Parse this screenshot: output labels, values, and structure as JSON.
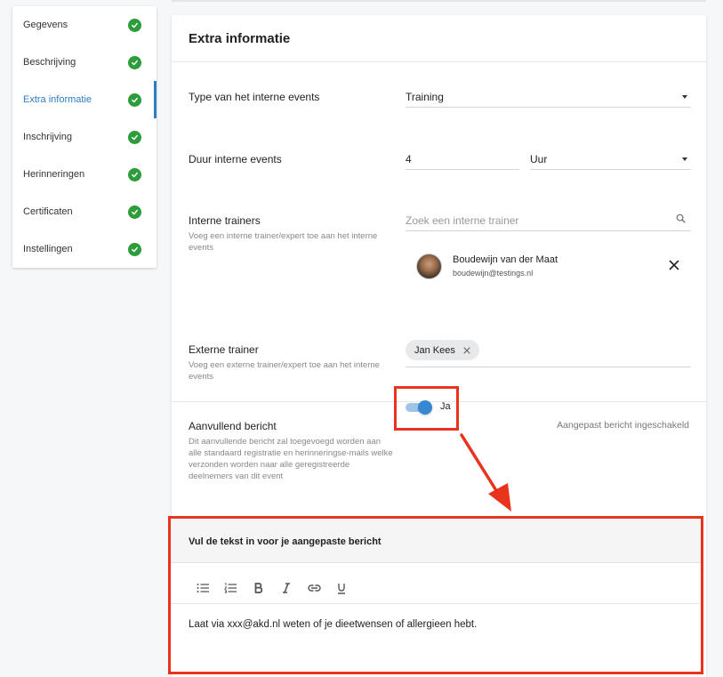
{
  "sidebar": {
    "items": [
      {
        "label": "Gegevens"
      },
      {
        "label": "Beschrijving"
      },
      {
        "label": "Extra informatie"
      },
      {
        "label": "Inschrijving"
      },
      {
        "label": "Herinneringen"
      },
      {
        "label": "Certificaten"
      },
      {
        "label": "Instellingen"
      }
    ],
    "active_index": 2,
    "check_color": "#2d9c3a",
    "accent_color": "#2b7fc1"
  },
  "card": {
    "title": "Extra informatie",
    "event_type": {
      "label": "Type van het interne events",
      "value": "Training"
    },
    "duration": {
      "label": "Duur interne events",
      "amount": "4",
      "unit": "Uur"
    },
    "internal_trainers": {
      "label": "Interne trainers",
      "description": "Voeg een interne trainer/expert toe aan het interne events",
      "search_placeholder": "Zoek een interne trainer",
      "trainer": {
        "name": "Boudewijn van der Maat",
        "email": "boudewijn@testings.nl"
      }
    },
    "external_trainer": {
      "label": "Externe trainer",
      "description": "Voeg een externe trainer/expert toe aan het interne events",
      "chip": "Jan Kees"
    },
    "additional_message": {
      "label": "Aanvullend bericht",
      "description": "Dit aanvullende bericht zal toegevoegd worden aan alle standaard registratie en herinneringse-mails welke verzonden worden naar alle geregistreerde deelnemers van dit event",
      "toggle_label": "Ja",
      "toggle_on": true,
      "status": "Aangepast bericht ingeschakeld"
    },
    "custom_message": {
      "title": "Vul de tekst in voor je aangepaste bericht",
      "text": "Laat via xxx@akd.nl weten of je dieetwensen of allergieen hebt.",
      "toolbar_icons": [
        "bulleted-list-icon",
        "numbered-list-icon",
        "bold-icon",
        "italic-icon",
        "link-icon",
        "underline-icon"
      ]
    }
  },
  "highlight_color": "#e8331d"
}
